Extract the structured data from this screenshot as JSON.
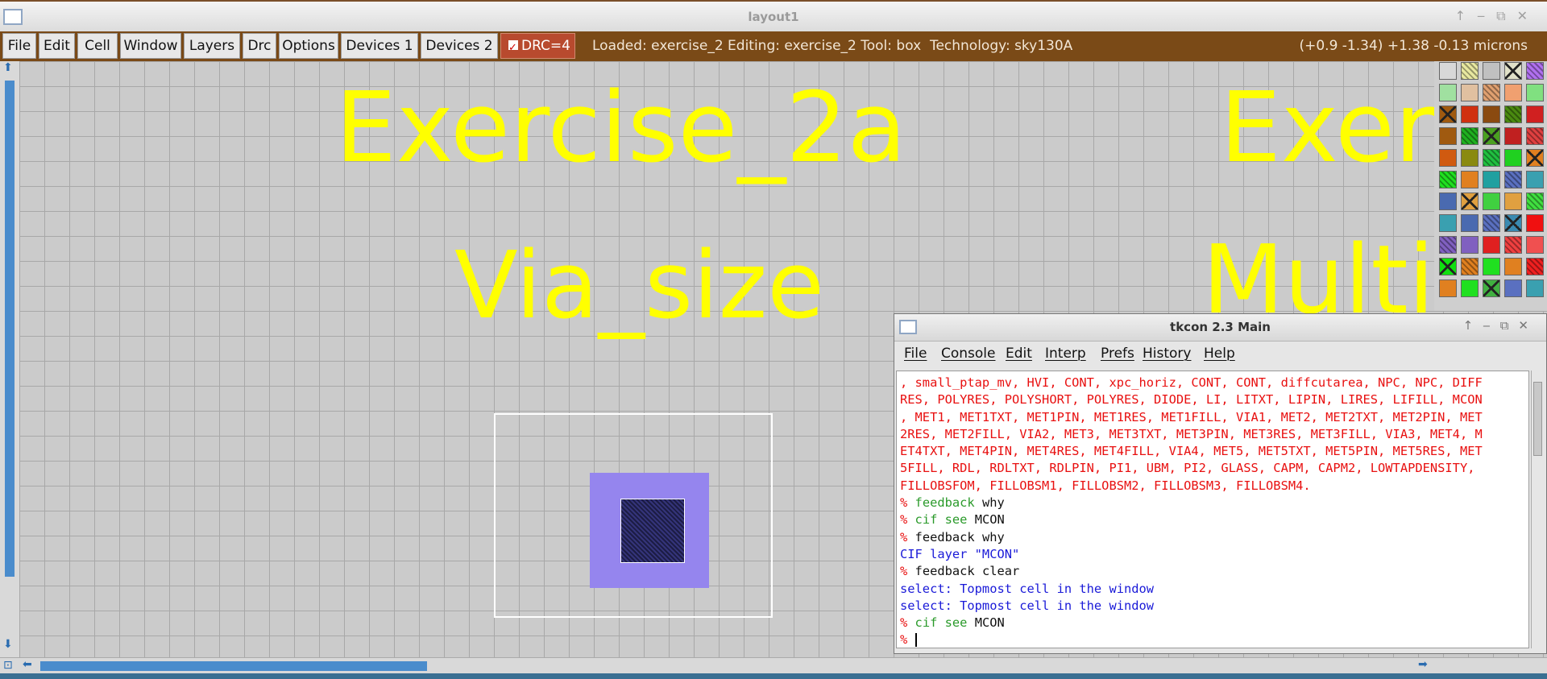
{
  "window": {
    "title": "layout1"
  },
  "menu": {
    "items": [
      "File",
      "Edit",
      "Cell",
      "Window",
      "Layers",
      "Drc",
      "Options",
      "Devices 1",
      "Devices 2"
    ],
    "drc_label": "DRC=4",
    "drc_checked": true
  },
  "status": {
    "text": "Loaded: exercise_2 Editing: exercise_2 Tool: box  Technology: sky130A",
    "coords": "(+0.9 -1.34) +1.38 -0.13 microns"
  },
  "canvas": {
    "labels": [
      "Exercise_2a",
      "Via_size",
      "Exer",
      "Multi"
    ]
  },
  "palette": {
    "colors": [
      "#d8d8d8",
      "#e8e8a0",
      "#c0c0c0",
      "#e0e0c8",
      "#b070f0",
      "#a0e0a0",
      "#e0c0a0",
      "#e0a070",
      "#f0a070",
      "#80e080",
      "#a05a10",
      "#d03010",
      "#8a4a10",
      "#4a8a10",
      "#d02020",
      "#a05a10",
      "#20b020",
      "#4aa020",
      "#c02020",
      "#e04040",
      "#d05a10",
      "#8a8a10",
      "#20c040",
      "#20d020",
      "#e08020",
      "#20e020",
      "#e08020",
      "#20a0a0",
      "#5a70c0",
      "#3aa0b0",
      "#4a6ab0",
      "#e0a040",
      "#40d040",
      "#e0a040",
      "#40e040",
      "#3aa0b0",
      "#4a6ab0",
      "#5a70c0",
      "#3a8ab0",
      "#f01010",
      "#8060c0",
      "#8060c0",
      "#e02020",
      "#f04040",
      "#f05050",
      "#10e010",
      "#e08020",
      "#20e020",
      "#e08020",
      "#f02020",
      "#e08020",
      "#20e020",
      "#40b040",
      "#5a70c0",
      "#3aa0b0"
    ]
  },
  "tkcon": {
    "title": "tkcon 2.3 Main",
    "menu": [
      "File",
      "Console",
      "Edit",
      "Interp",
      "Prefs",
      "History",
      "Help"
    ],
    "lines": [
      {
        "cls": "red",
        "text": ", small_ptap_mv, HVI, CONT, xpc_horiz, CONT, CONT, diffcutarea, NPC, NPC, DIFF"
      },
      {
        "cls": "red",
        "text": "RES, POLYRES, POLYSHORT, POLYRES, DIODE, LI, LITXT, LIPIN, LIRES, LIFILL, MCON"
      },
      {
        "cls": "red",
        "text": ", MET1, MET1TXT, MET1PIN, MET1RES, MET1FILL, VIA1, MET2, MET2TXT, MET2PIN, MET"
      },
      {
        "cls": "red",
        "text": "2RES, MET2FILL, VIA2, MET3, MET3TXT, MET3PIN, MET3RES, MET3FILL, VIA3, MET4, M"
      },
      {
        "cls": "red",
        "text": "ET4TXT, MET4PIN, MET4RES, MET4FILL, VIA4, MET5, MET5TXT, MET5PIN, MET5RES, MET"
      },
      {
        "cls": "red",
        "text": "5FILL, RDL, RDLTXT, RDLPIN, PI1, UBM, PI2, GLASS, CAPM, CAPM2, LOWTAPDENSITY,"
      },
      {
        "cls": "red",
        "text": "FILLOBSFOM, FILLOBSM1, FILLOBSM2, FILLOBSM3, FILLOBSM4."
      },
      {
        "prompt": "% ",
        "cmd": "feedback",
        "cmdcls": "grn",
        "arg": " why"
      },
      {
        "prompt": "% ",
        "cmd": "cif see",
        "cmdcls": "grn",
        "arg": " MCON"
      },
      {
        "prompt": "% ",
        "cmd": "feedback why",
        "cmdcls": "blk",
        "arg": ""
      },
      {
        "cls": "blu",
        "text": "CIF layer \"MCON\""
      },
      {
        "prompt": "% ",
        "cmd": "feedback clear",
        "cmdcls": "blk",
        "arg": ""
      },
      {
        "cls": "blu",
        "text": "select: Topmost cell in the window"
      },
      {
        "cls": "blu",
        "text": "select: Topmost cell in the window"
      },
      {
        "prompt": "% ",
        "cmd": "cif see",
        "cmdcls": "grn",
        "arg": " MCON"
      },
      {
        "prompt": "% ",
        "cmd": "",
        "cmdcls": "blk",
        "arg": "",
        "cursor": true
      }
    ]
  }
}
